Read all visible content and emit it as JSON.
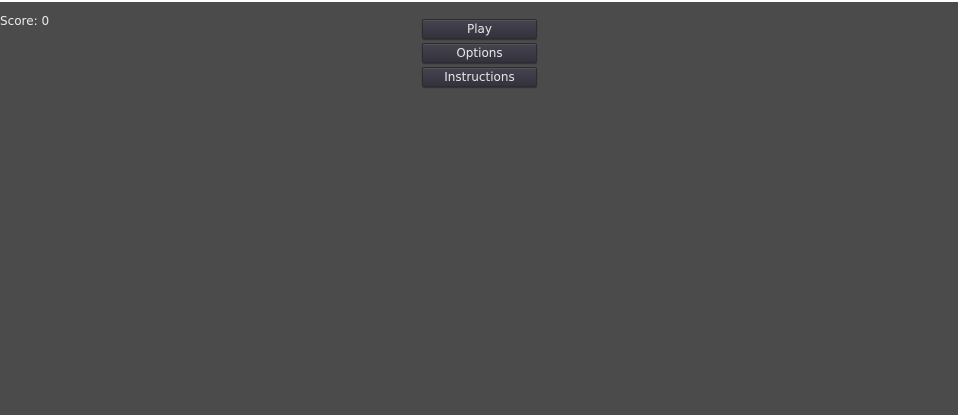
{
  "hud": {
    "score_text": "Score: 0"
  },
  "menu": {
    "buttons": [
      {
        "label": "Play"
      },
      {
        "label": "Options"
      },
      {
        "label": "Instructions"
      }
    ]
  },
  "colors": {
    "background": "#4b4b4b",
    "button_face": "#3d3c46",
    "button_border": "#2c2c33",
    "text": "#e6e6e6"
  }
}
